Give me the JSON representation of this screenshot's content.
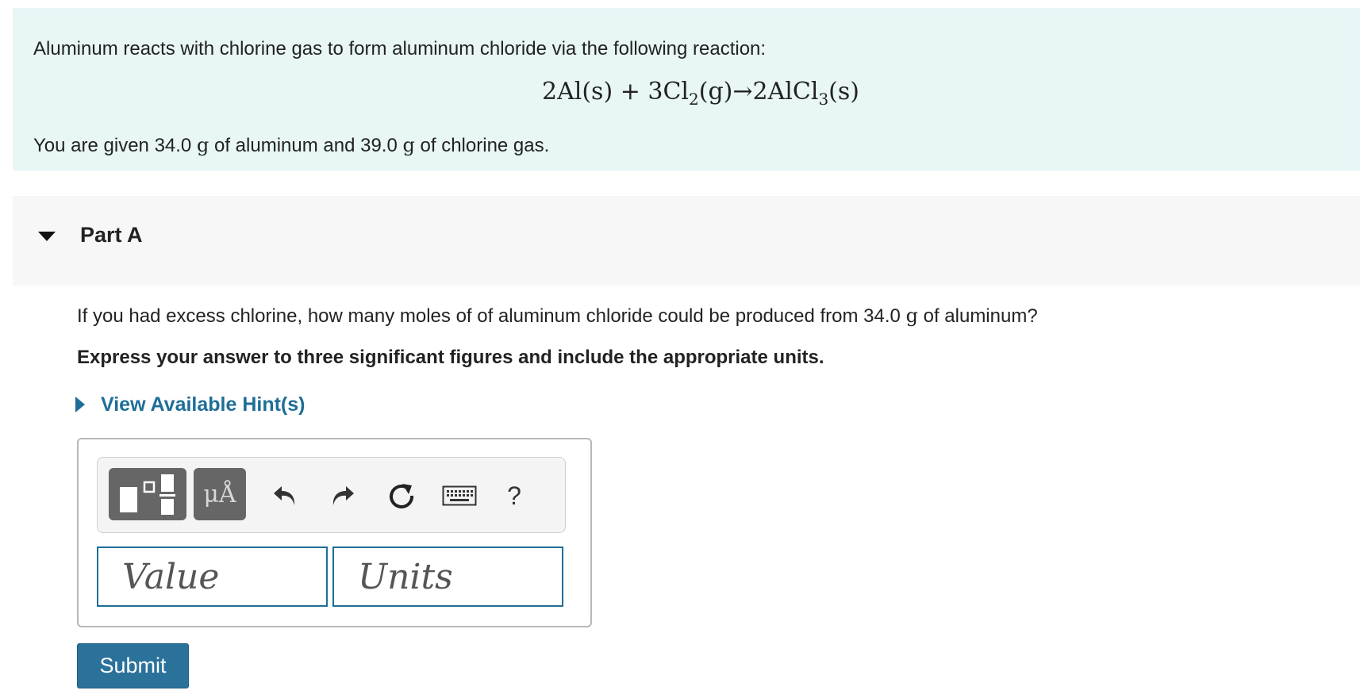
{
  "problem": {
    "intro": "Aluminum reacts with chlorine gas to form aluminum chloride via the following reaction:",
    "equation": {
      "reactant1": "2Al(s)",
      "plus": "+",
      "reactant2_pre": "3Cl",
      "reactant2_sub": "2",
      "reactant2_post": "(g)",
      "arrow": "→",
      "product_pre": "2AlCl",
      "product_sub": "3",
      "product_post": "(s)"
    },
    "given_pre": "You are given 34.0 ",
    "given_unit1": "g",
    "given_mid": " of aluminum and 39.0 ",
    "given_unit2": "g",
    "given_post": " of chlorine gas."
  },
  "part": {
    "title": "Part A",
    "question_pre": "If you had excess chlorine, how many moles of of aluminum chloride could be produced from 34.0 ",
    "question_unit": "g",
    "question_post": " of aluminum?",
    "instruction": "Express your answer to three significant figures and include the appropriate units.",
    "hint_label": "View Available Hint(s)"
  },
  "answer": {
    "toolbar": {
      "units_label": "μÅ",
      "help_label": "?",
      "icons": [
        "templates-icon",
        "units-icon",
        "undo-icon",
        "redo-icon",
        "reset-icon",
        "keyboard-icon",
        "help-icon"
      ]
    },
    "value_placeholder": "Value",
    "units_placeholder": "Units"
  },
  "submit_label": "Submit",
  "colors": {
    "intro_bg": "#e8f6f6",
    "part_bg": "#f7f7f7",
    "accent": "#1e6e97",
    "submit_bg": "#2b729b",
    "tool_btn": "#666666"
  }
}
